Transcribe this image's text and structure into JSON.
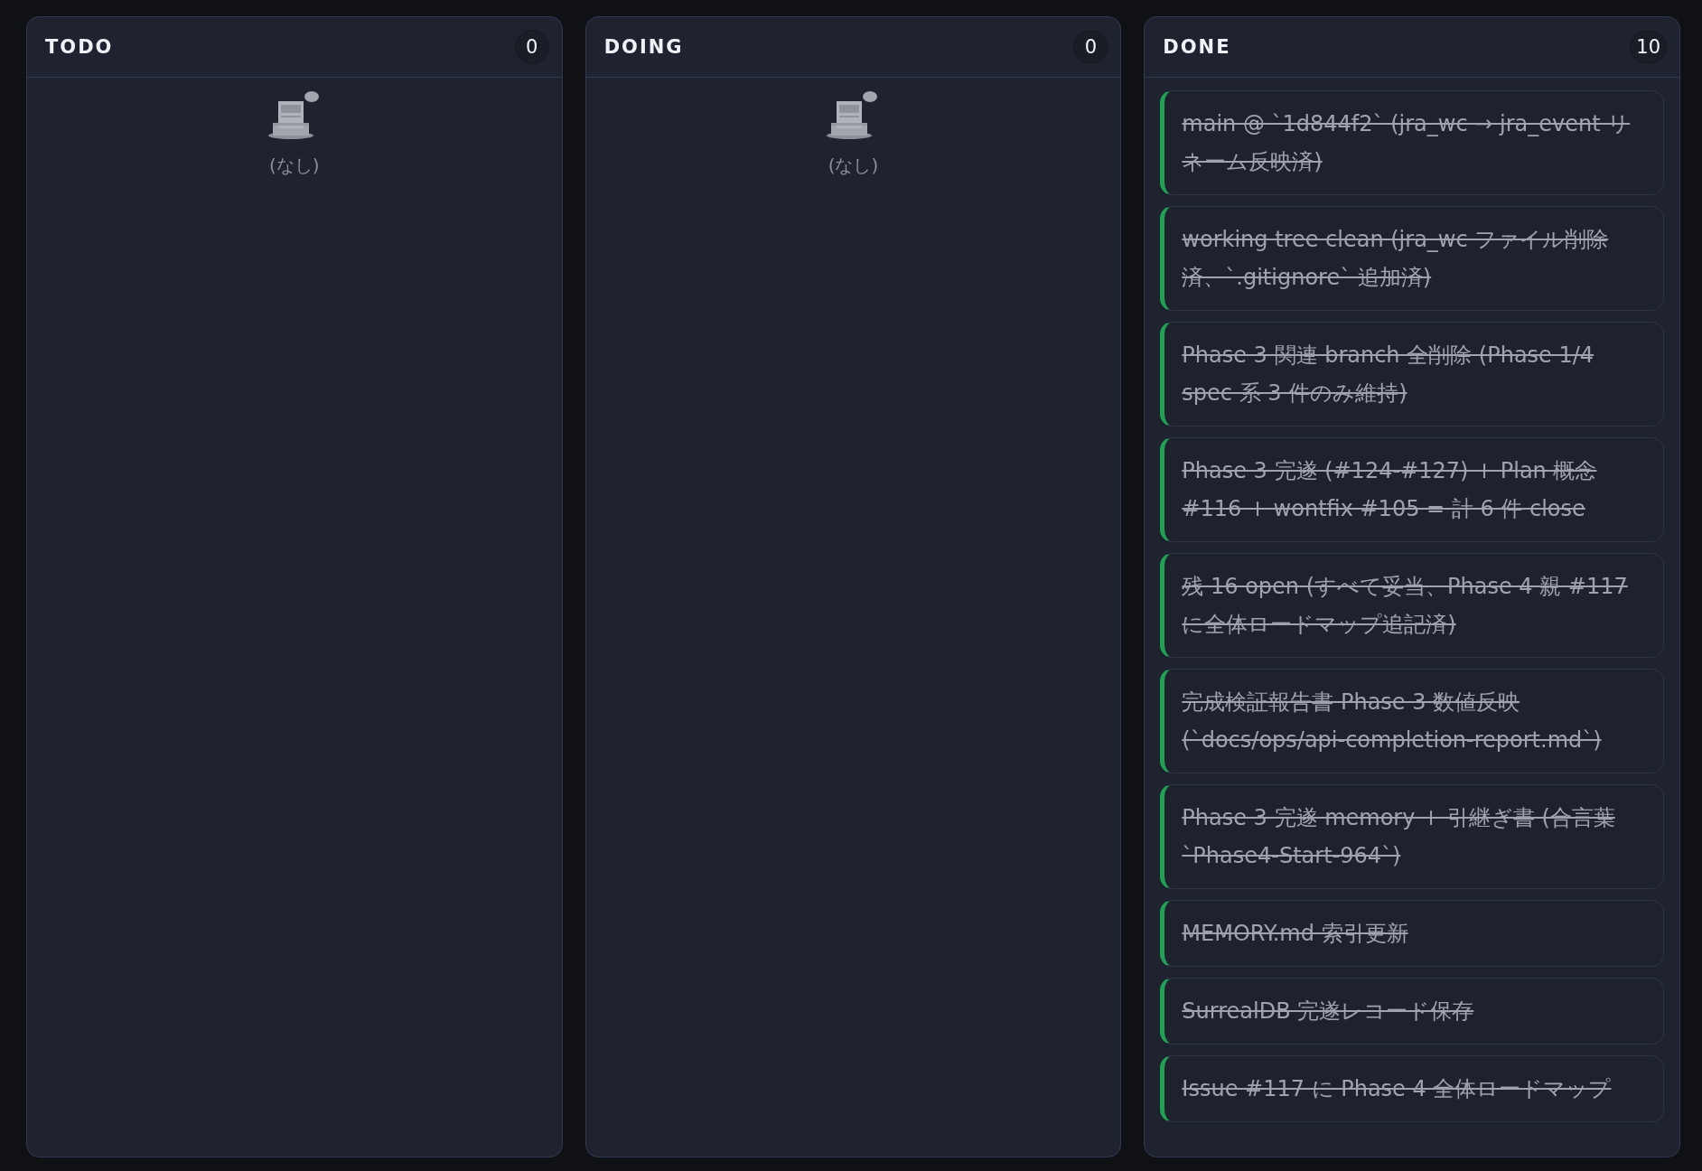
{
  "columns": [
    {
      "title": "TODO",
      "count": "0",
      "empty_text": "(なし)"
    },
    {
      "title": "DOING",
      "count": "0",
      "empty_text": "(なし)"
    },
    {
      "title": "DONE",
      "count": "10",
      "cards": [
        {
          "text": "main @ `1d844f2` (jra_wc → jra_event リネーム反映済)",
          "done": true
        },
        {
          "text": "working tree clean (jra_wc ファイル削除済、`.gitignore` 追加済)",
          "done": true
        },
        {
          "text": "Phase 3 関連 branch 全削除 (Phase 1/4 spec 系 3 件のみ維持)",
          "done": true
        },
        {
          "text": "Phase 3 完遂 (#124-#127) + Plan 概念 #116 + wontfix #105 = 計 6 件 close",
          "done": true
        },
        {
          "text": "残 16 open (すべて妥当、Phase 4 親 #117 に全体ロードマップ追記済)",
          "done": true
        },
        {
          "text": "完成検証報告書 Phase 3 数値反映 (`docs/ops/api-completion-report.md`)",
          "done": true
        },
        {
          "text": "Phase 3 完遂 memory + 引継ぎ書 (合言葉 `Phase4-Start-964`)",
          "done": true
        },
        {
          "text": "MEMORY.md 索引更新",
          "done": true
        },
        {
          "text": "SurrealDB 完遂レコード保存",
          "done": true
        },
        {
          "text": "Issue #117 に Phase 4 全体ロードマップ",
          "done": true
        }
      ]
    }
  ]
}
